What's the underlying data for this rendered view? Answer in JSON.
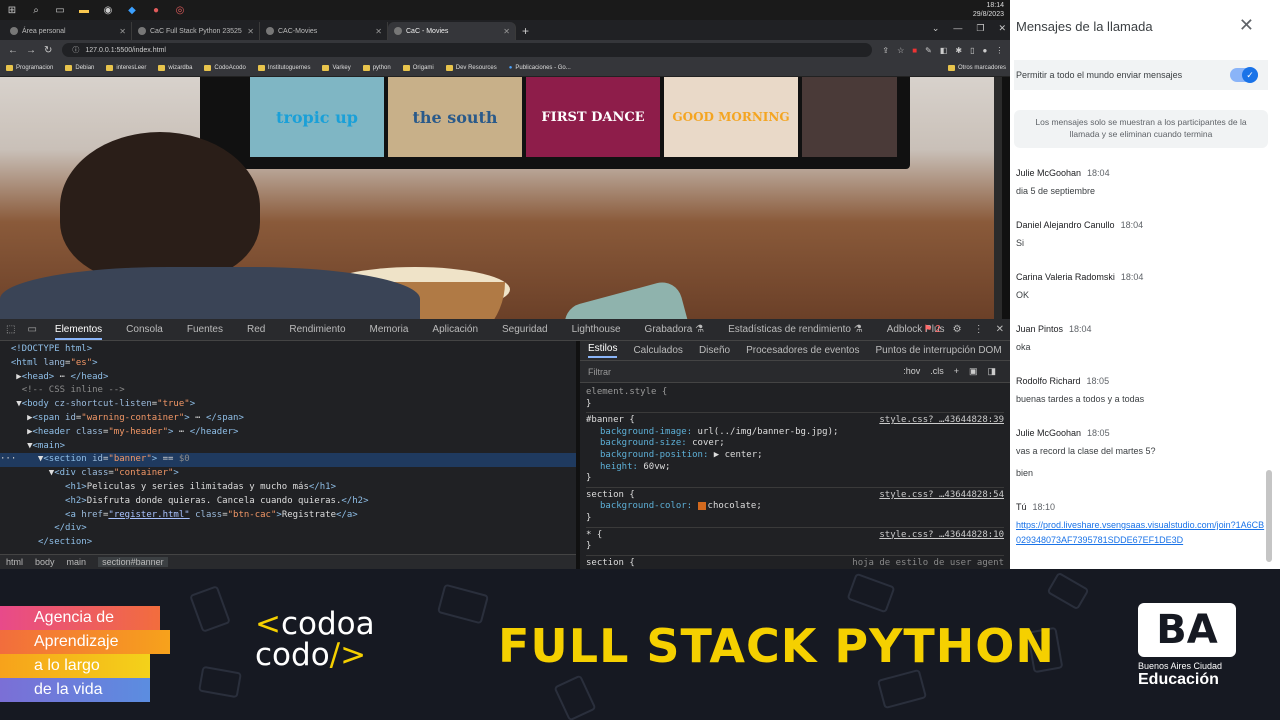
{
  "taskbar": {
    "time": "18:14",
    "date": "29/8/2023"
  },
  "browser": {
    "tabs": [
      {
        "title": "Área personal"
      },
      {
        "title": "CaC Full Stack Python 23525"
      },
      {
        "title": "CAC-Movies"
      },
      {
        "title": "CaC - Movies",
        "active": true
      }
    ],
    "url": "127.0.0.1:5500/index.html",
    "bookmarks": [
      "Programacion",
      "Debian",
      "interesLeer",
      "wizardba",
      "CodoAcodo",
      "Institutoguernes",
      "Varkey",
      "python",
      "Origami",
      "Dev Resources",
      "Publicaciones - Go..."
    ],
    "other_bookmarks": "Otros marcadores"
  },
  "hero": {
    "posters": [
      "tropic up",
      "the south",
      "FIRST DANCE",
      "GOOD MORNING",
      ""
    ]
  },
  "devtools": {
    "tabs": [
      "Elementos",
      "Consola",
      "Fuentes",
      "Red",
      "Rendimiento",
      "Memoria",
      "Aplicación",
      "Seguridad",
      "Lighthouse",
      "Grabadora ⚗",
      "Estadísticas de rendimiento ⚗",
      "Adblock Plus"
    ],
    "active_tab": "Elementos",
    "error_count": "2",
    "breadcrumb": [
      "html",
      "body",
      "main",
      "section#banner"
    ],
    "sidebar_tabs": [
      "Estilos",
      "Calculados",
      "Diseño",
      "Procesadores de eventos",
      "Puntos de interrupción DOM"
    ],
    "filter_placeholder": "Filtrar",
    "filter_tools": [
      ":hov",
      ".cls",
      "+"
    ],
    "styles": {
      "element_style": "element.style {",
      "banner_selector": "#banner {",
      "banner_src": "style.css?_…43644828:39",
      "banner_props": [
        [
          "background-image",
          "url(../img/banner-bg.jpg);"
        ],
        [
          "background-size",
          "cover;"
        ],
        [
          "background-position",
          "▶ center;"
        ],
        [
          "height",
          "60vw;"
        ]
      ],
      "section_selector": "section {",
      "section_src": "style.css?_…43644828:54",
      "section_prop": [
        "background-color",
        "chocolate;"
      ],
      "star_selector": "* {",
      "star_src": "style.css?_…43644828:10",
      "last_selector": "section {",
      "last_src": "hoja de estilo de user agent"
    }
  },
  "chat": {
    "title": "Mensajes de la llamada",
    "permission": "Permitir a todo el mundo enviar mensajes",
    "notice": "Los mensajes solo se muestran a los participantes de la llamada y se eliminan cuando termina",
    "messages": [
      {
        "who": "Julie McGoohan",
        "time": "18:04",
        "text": "dia 5 de septiembre"
      },
      {
        "who": "Daniel Alejandro Canullo",
        "time": "18:04",
        "text": "Si"
      },
      {
        "who": "Carina Valeria Radomski",
        "time": "18:04",
        "text": "OK"
      },
      {
        "who": "Juan Pintos",
        "time": "18:04",
        "text": "oka"
      },
      {
        "who": "Rodolfo Richard",
        "time": "18:05",
        "text": "buenas tardes a todos y a todas"
      },
      {
        "who": "Julie McGoohan",
        "time": "18:05",
        "text": "vas a record la clase del martes 5?",
        "text2": "bien"
      },
      {
        "who": "Tú",
        "time": "18:10",
        "link": "https://prod.liveshare.vsengsaas.visualstudio.com/join?1A6CB029348073AF7395781SDDE67EF1DE3D"
      }
    ]
  },
  "banner": {
    "agencia": [
      "Agencia de",
      "Aprendizaje",
      "a lo largo",
      "de la vida"
    ],
    "codo_line1a": "<",
    "codo_line1b": "codo",
    "codo_line1c": "a",
    "codo_line2a": "codo",
    "codo_line2b": "/>",
    "title": "FULL STACK PYTHON",
    "ba_logo": "BA",
    "ba_city": "Buenos Aires Ciudad",
    "ba_edu": "Educación"
  }
}
